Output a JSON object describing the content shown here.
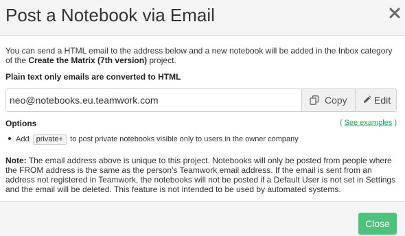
{
  "dialog": {
    "title": "Post a Notebook via Email"
  },
  "intro": {
    "text_before": "You can send a HTML email to the address below and a new notebook will be added in the Inbox category of the ",
    "project_name": "Create the Matrix (7th version)",
    "text_after": " project."
  },
  "plain_note": "Plain text only emails are converted to HTML",
  "email": {
    "value": "neo@notebooks.eu.teamwork.com",
    "copy_label": "Copy",
    "edit_label": "Edit"
  },
  "options": {
    "label": "Options",
    "see_open": "( ",
    "see_examples": "See examples",
    "see_close": " )",
    "item_prefix": "Add",
    "item_tag": "private+",
    "item_suffix": "to post private notebooks visible only to users in the owner company"
  },
  "note": {
    "label": "Note:",
    "text": " The email address above is unique to this project. Notebooks will only be posted from people where the FROM address is the same as the person's Teamwork email address. If the email is sent from an address not registered in Teamwork, the notebooks will not be posted if a Default User is not set in Settings and the email will be deleted. This feature is not intended to be used by automated systems."
  },
  "footer": {
    "close_label": "Close"
  },
  "colors": {
    "accent_green": "#4cc27c",
    "link_green": "#2aa35a"
  },
  "icons": {
    "close": "close-icon",
    "copy": "copy-icon",
    "edit": "pencil-icon"
  }
}
